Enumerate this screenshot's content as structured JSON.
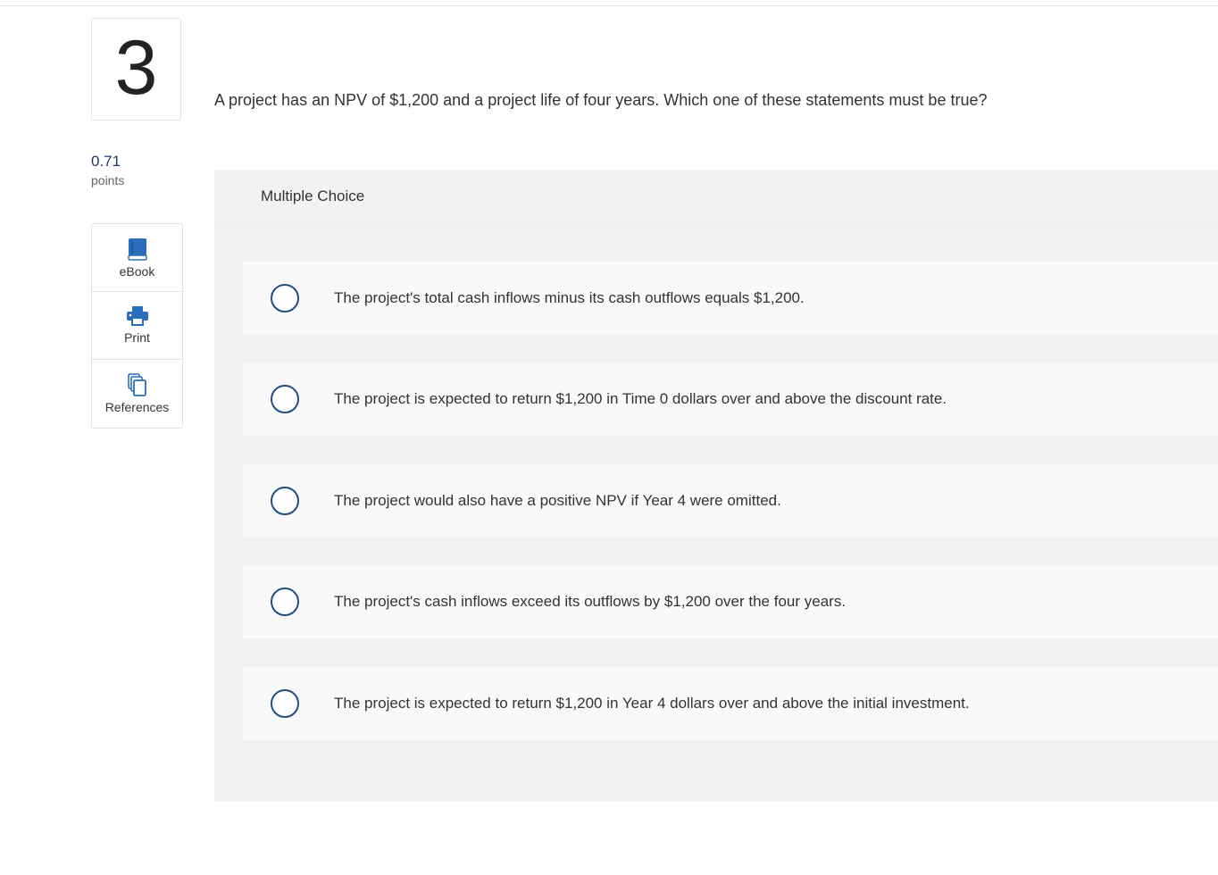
{
  "question": {
    "number": "3",
    "points_value": "0.71",
    "points_label": "points",
    "text": "A project has an NPV of $1,200 and a project life of four years. Which one of these statements must be true?"
  },
  "tools": [
    {
      "label": "eBook",
      "icon": "book-icon"
    },
    {
      "label": "Print",
      "icon": "printer-icon"
    },
    {
      "label": "References",
      "icon": "documents-icon"
    }
  ],
  "multiple_choice": {
    "title": "Multiple Choice",
    "options": [
      {
        "text": "The project's total cash inflows minus its cash outflows equals $1,200.",
        "selected": false
      },
      {
        "text": "The project is expected to return $1,200 in Time 0 dollars over and above the discount rate.",
        "selected": false
      },
      {
        "text": "The project would also have a positive NPV if Year 4 were omitted.",
        "selected": false
      },
      {
        "text": "The project's cash inflows exceed its outflows by $1,200 over the four years.",
        "selected": false
      },
      {
        "text": "The project is expected to return $1,200 in Year 4 dollars over and above the initial investment.",
        "selected": false
      }
    ]
  },
  "colors": {
    "accent": "#1f4e86",
    "icon_blue": "#2a6ebb",
    "panel_bg": "#f2f2f2",
    "option_bg": "#f9f9f9"
  }
}
